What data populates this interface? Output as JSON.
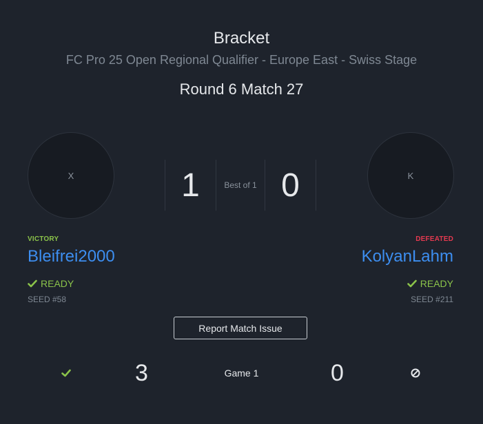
{
  "header": {
    "title": "Bracket",
    "subtitle": "FC Pro 25 Open Regional Qualifier - Europe East - Swiss Stage",
    "round": "Round 6 Match 27"
  },
  "match": {
    "score_left": "1",
    "score_right": "0",
    "best_of": "Best of 1"
  },
  "player_left": {
    "avatar_initial": "X",
    "result": "VICTORY",
    "name": "Bleifrei2000",
    "status": "READY",
    "seed": "SEED #58"
  },
  "player_right": {
    "avatar_initial": "K",
    "result": "DEFEATED",
    "name": "KolyanLahm",
    "status": "READY",
    "seed": "SEED #211"
  },
  "actions": {
    "report_label": "Report Match Issue"
  },
  "games": [
    {
      "label": "Game 1",
      "score_left": "3",
      "score_right": "0",
      "left_icon": "check-icon",
      "right_icon": "forfeit-icon"
    }
  ],
  "colors": {
    "background": "#1e232c",
    "victory": "#8bc34a",
    "defeated": "#e53950",
    "link": "#3d8ef0",
    "ready": "#8bc34a"
  }
}
